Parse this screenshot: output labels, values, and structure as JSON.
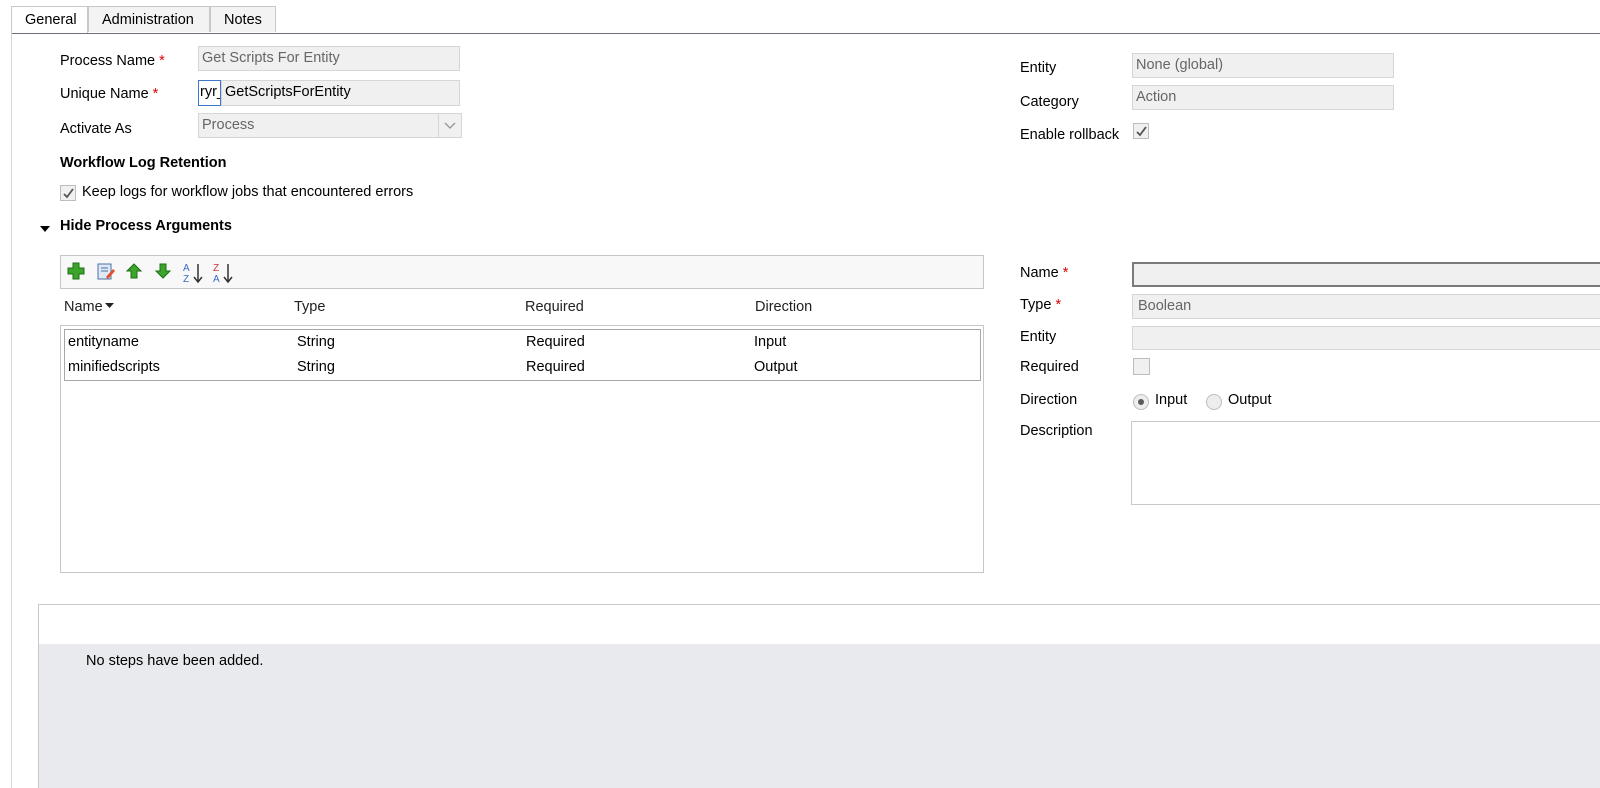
{
  "tabs": [
    {
      "label": "General",
      "active": true
    },
    {
      "label": "Administration",
      "active": false
    },
    {
      "label": "Notes",
      "active": false
    }
  ],
  "general": {
    "process_name_label": "Process Name",
    "process_name_value": "Get Scripts For Entity",
    "unique_name_label": "Unique Name",
    "unique_name_prefix": "ryr_",
    "unique_name_value": "GetScriptsForEntity",
    "activate_as_label": "Activate As",
    "activate_as_value": "Process",
    "log_retention_heading": "Workflow Log Retention",
    "keep_logs_label": "Keep logs for workflow jobs that encountered errors",
    "keep_logs_checked": true,
    "entity_label": "Entity",
    "entity_value": "None (global)",
    "category_label": "Category",
    "category_value": "Action",
    "enable_rollback_label": "Enable rollback",
    "enable_rollback_checked": true,
    "required_marker": "*"
  },
  "arguments": {
    "section_toggle_label": "Hide Process Arguments",
    "toolbar_icons": [
      "add-icon",
      "edit-icon",
      "move-up-icon",
      "move-down-icon",
      "sort-ascending-icon",
      "sort-descending-icon"
    ],
    "columns": [
      "Name",
      "Type",
      "Required",
      "Direction"
    ],
    "rows": [
      {
        "name": "entityname",
        "type": "String",
        "required": "Required",
        "direction": "Input"
      },
      {
        "name": "minifiedscripts",
        "type": "String",
        "required": "Required",
        "direction": "Output"
      }
    ]
  },
  "argument_detail": {
    "name_label": "Name",
    "name_value": "",
    "type_label": "Type",
    "type_value": "Boolean",
    "entity_label": "Entity",
    "entity_value": "",
    "required_label": "Required",
    "required_checked": false,
    "direction_label": "Direction",
    "direction_options": [
      "Input",
      "Output"
    ],
    "direction_selected": "Input",
    "description_label": "Description",
    "description_value": ""
  },
  "steps": {
    "empty_message": "No steps have been added."
  },
  "colors": {
    "required_marker": "#e00000",
    "field_background": "#f0f0f0",
    "steps_background": "#e8eaed",
    "add_icon": "#3aa52a",
    "arrow_icon": "#3aa52a"
  }
}
